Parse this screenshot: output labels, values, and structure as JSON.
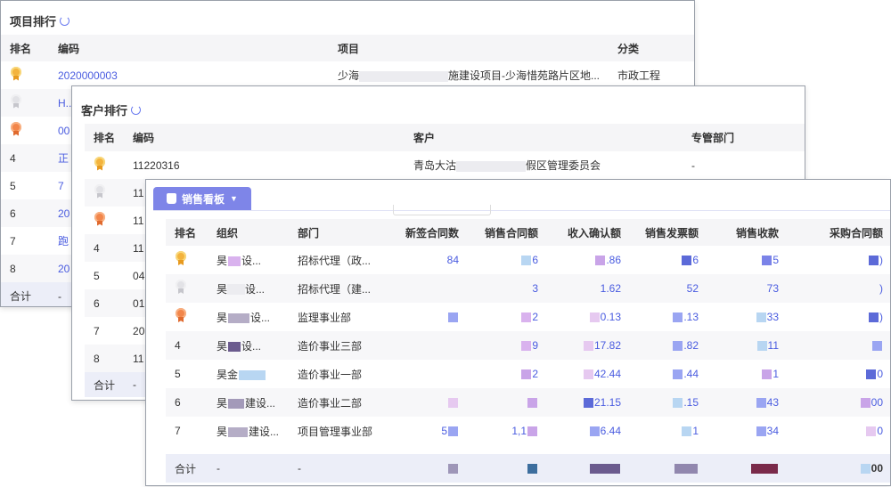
{
  "project": {
    "title": "项目排行",
    "headers": [
      "排名",
      "编码",
      "项目",
      "分类"
    ],
    "rows": [
      {
        "rank": "",
        "code": "2020000003",
        "project_a": "少海",
        "project_b": "施建设项目-少海惜苑路片区地...",
        "category": "市政工程"
      },
      {
        "rank": "",
        "code": "H...",
        "project_a": "",
        "project_b": "",
        "category": ""
      },
      {
        "rank": "",
        "code": "00",
        "project_a": "",
        "project_b": "",
        "category": ""
      },
      {
        "rank": "4",
        "code": "正",
        "project_a": "",
        "project_b": "",
        "category": ""
      },
      {
        "rank": "5",
        "code": "7",
        "project_a": "",
        "project_b": "",
        "category": ""
      },
      {
        "rank": "6",
        "code": "20",
        "project_a": "",
        "project_b": "",
        "category": ""
      },
      {
        "rank": "7",
        "code": "跑",
        "project_a": "",
        "project_b": "",
        "category": ""
      },
      {
        "rank": "8",
        "code": "20",
        "project_a": "",
        "project_b": "",
        "category": ""
      }
    ],
    "total_label": "合计",
    "total_dash": "-"
  },
  "customer": {
    "title": "客户排行",
    "headers": [
      "排名",
      "编码",
      "客户",
      "专管部门"
    ],
    "rows": [
      {
        "rank": "",
        "code": "11220316",
        "customer_a": "青岛大沽",
        "customer_b": "假区管理委员会",
        "dept": "-"
      },
      {
        "rank": "",
        "code": "11",
        "customer_a": "",
        "customer_b": "",
        "dept": ""
      },
      {
        "rank": "",
        "code": "11",
        "customer_a": "",
        "customer_b": "",
        "dept": ""
      },
      {
        "rank": "4",
        "code": "11",
        "customer_a": "",
        "customer_b": "",
        "dept": ""
      },
      {
        "rank": "5",
        "code": "04",
        "customer_a": "",
        "customer_b": "",
        "dept": ""
      },
      {
        "rank": "6",
        "code": "01",
        "customer_a": "",
        "customer_b": "",
        "dept": ""
      },
      {
        "rank": "7",
        "code": "20",
        "customer_a": "",
        "customer_b": "",
        "dept": ""
      },
      {
        "rank": "8",
        "code": "11",
        "customer_a": "",
        "customer_b": "",
        "dept": ""
      }
    ],
    "total_label": "合计",
    "total_dash": "-"
  },
  "sales": {
    "tab_label": "销售看板",
    "headers": [
      "排名",
      "组织",
      "部门",
      "新签合同数",
      "销售合同额",
      "收入确认额",
      "销售发票额",
      "销售收款",
      "采购合同额"
    ],
    "rows": [
      {
        "rank": "",
        "org_a": "昊",
        "org_b": "设...",
        "dept": "招标代理（政...",
        "new_contracts": "84",
        "contract_amt": "6",
        "revenue": ".86",
        "invoice": "6",
        "receipts": "5",
        "purchase": ")"
      },
      {
        "rank": "",
        "org_a": "昊",
        "org_b": "设...",
        "dept": "招标代理（建...",
        "new_contracts": "",
        "contract_amt": "3",
        "revenue": "1.62",
        "invoice": "52",
        "receipts": "73",
        "purchase": ")"
      },
      {
        "rank": "",
        "org_a": "昊",
        "org_b": "设...",
        "dept": "监理事业部",
        "new_contracts": "",
        "contract_amt": "2",
        "revenue": "0.13",
        "invoice": ".13",
        "receipts": "33",
        "purchase": ")"
      },
      {
        "rank": "4",
        "org_a": "昊",
        "org_b": "设...",
        "dept": "造价事业三部",
        "new_contracts": "",
        "contract_amt": "9",
        "revenue": "17.82",
        "invoice": ".82",
        "receipts": "11",
        "purchase": ""
      },
      {
        "rank": "5",
        "org_a": "昊金",
        "org_b": "",
        "dept": "造价事业一部",
        "new_contracts": "",
        "contract_amt": "2",
        "revenue": "42.44",
        "invoice": ".44",
        "receipts": "1",
        "purchase": "0"
      },
      {
        "rank": "6",
        "org_a": "昊",
        "org_b": "建设...",
        "dept": "造价事业二部",
        "new_contracts": "",
        "contract_amt": "",
        "revenue": "21.15",
        "invoice": ".15",
        "receipts": "43",
        "purchase": "00"
      },
      {
        "rank": "7",
        "org_a": "昊",
        "org_b": "建设...",
        "dept": "项目管理事业部",
        "new_contracts": "5",
        "contract_amt": "1,1",
        "revenue": "6.44",
        "invoice": "1",
        "receipts": "34",
        "purchase": "0"
      }
    ],
    "total_label": "合计",
    "total_dash": "-",
    "total_last": "00"
  }
}
